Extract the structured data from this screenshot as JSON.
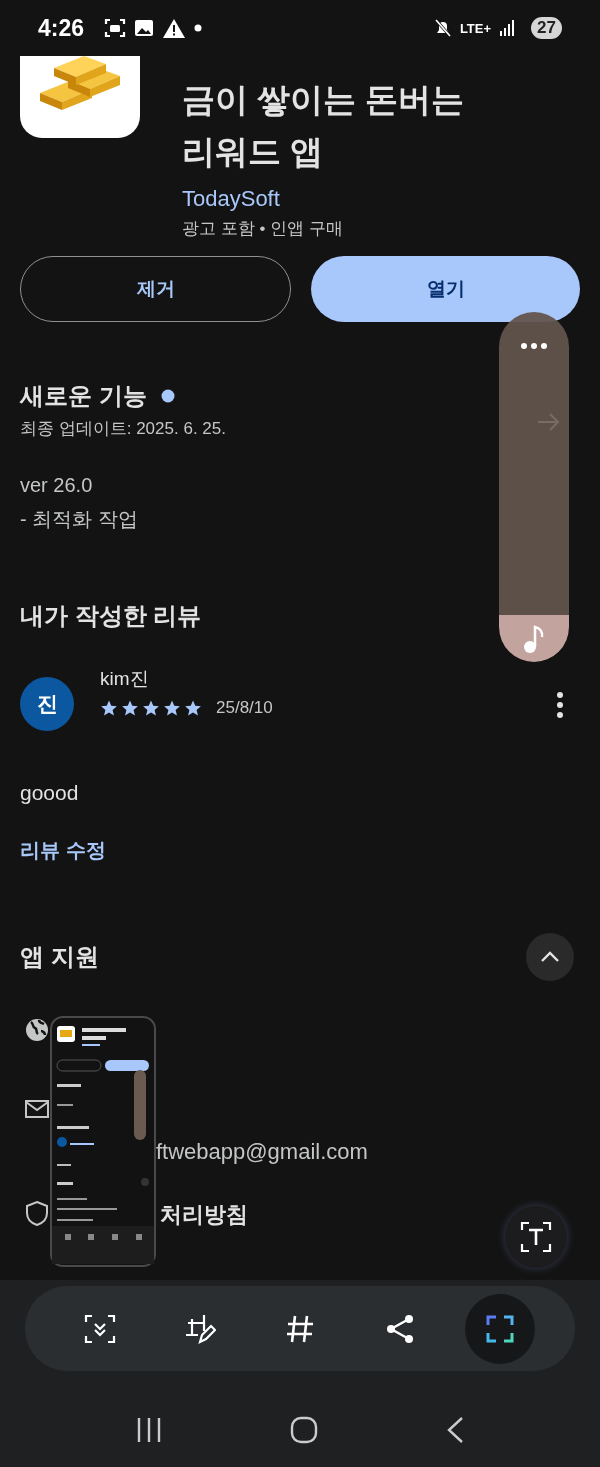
{
  "status_bar": {
    "time": "4:26",
    "network": "LTE+",
    "battery": "27"
  },
  "app": {
    "title": "금이 쌓이는 돈버는\n리워드 앱",
    "developer": "TodaySoft",
    "meta": "광고 포함 • 인앱 구매"
  },
  "actions": [
    {
      "label": "제거",
      "kind": "outline"
    },
    {
      "label": "열기",
      "kind": "filled"
    }
  ],
  "whats_new": {
    "title": "새로운 기능",
    "unread": true,
    "updated": "최종 업데이트: 2025. 6. 25.",
    "lines": [
      "ver 26.0",
      "- 최적화 작업"
    ]
  },
  "my_review": {
    "title": "내가 작성한 리뷰",
    "avatar": "진",
    "author": "kim진",
    "stars": 5,
    "date": "25/8/10",
    "text": "goood",
    "edit_link": "리뷰 수정"
  },
  "app_support": {
    "title": "앱 지원",
    "expanded": true,
    "items": [
      {
        "kind": "website"
      },
      {
        "kind": "email",
        "detail": "ftwebapp@gmail.com"
      },
      {
        "kind": "privacy",
        "label": "처리방침"
      }
    ]
  }
}
